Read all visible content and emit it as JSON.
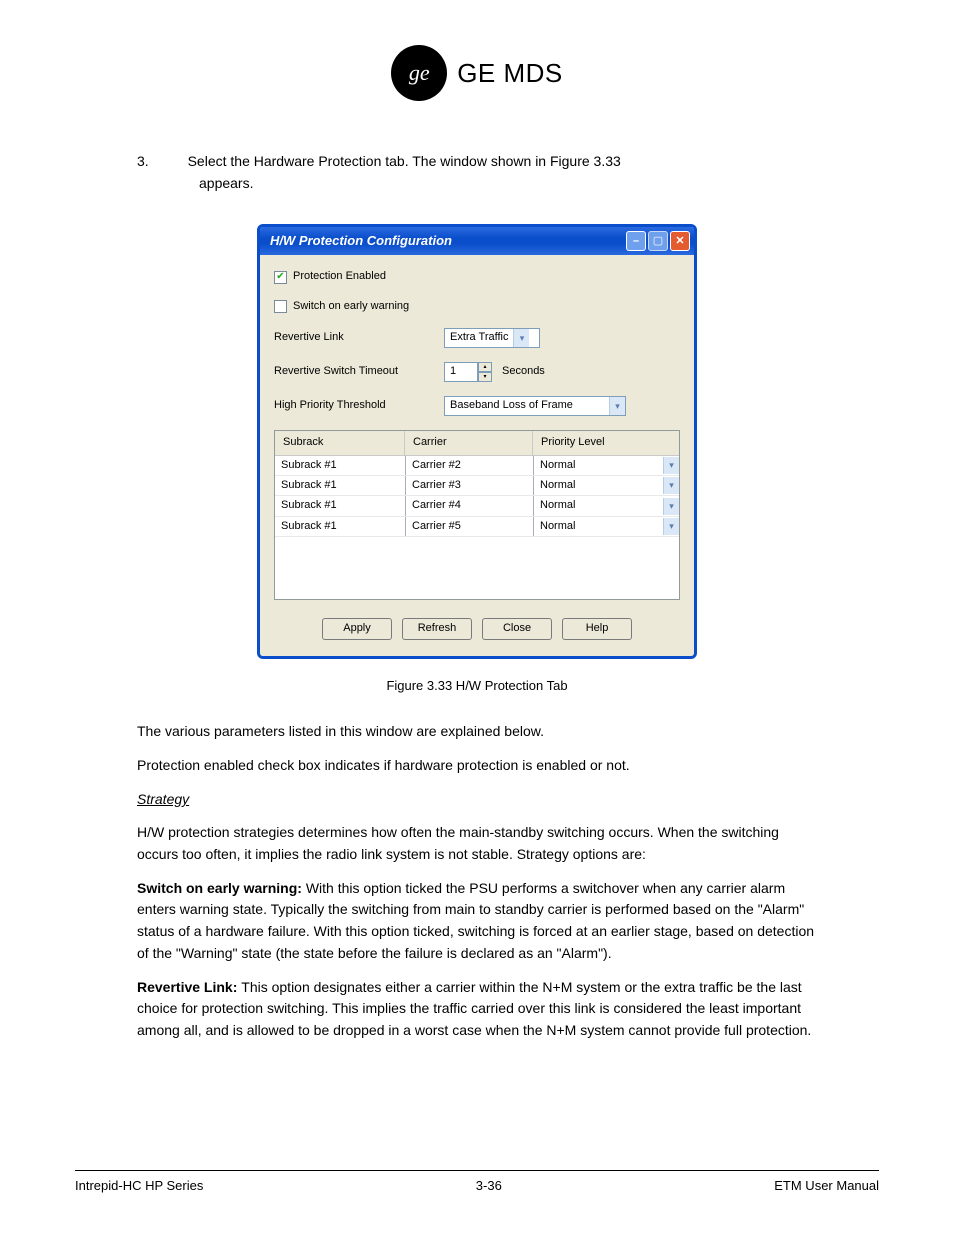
{
  "logo": {
    "monogram": "ge",
    "text": "GE MDS"
  },
  "intro": {
    "line1": "3.",
    "line1rest": "Select the Hardware Protection tab. The window shown in Figure 3.33",
    "line2": "appears."
  },
  "dialog": {
    "title": "H/W Protection Configuration",
    "checkboxes": {
      "protection_enabled": {
        "label": "Protection Enabled",
        "checked": true
      },
      "switch_early": {
        "label": "Switch on early warning",
        "checked": false
      }
    },
    "fields": {
      "revertive_link": {
        "label": "Revertive Link",
        "value": "Extra Traffic"
      },
      "revertive_timeout": {
        "label": "Revertive Switch Timeout",
        "value": "1",
        "unit": "Seconds"
      },
      "high_priority": {
        "label": "High Priority Threshold",
        "value": "Baseband Loss of Frame"
      }
    },
    "table": {
      "headers": {
        "subrack": "Subrack",
        "carrier": "Carrier",
        "priority": "Priority Level"
      },
      "rows": [
        {
          "subrack": "Subrack #1",
          "carrier": "Carrier #2",
          "priority": "Normal"
        },
        {
          "subrack": "Subrack #1",
          "carrier": "Carrier #3",
          "priority": "Normal"
        },
        {
          "subrack": "Subrack #1",
          "carrier": "Carrier #4",
          "priority": "Normal"
        },
        {
          "subrack": "Subrack #1",
          "carrier": "Carrier #5",
          "priority": "Normal"
        }
      ]
    },
    "buttons": {
      "apply": "Apply",
      "refresh": "Refresh",
      "close": "Close",
      "help": "Help"
    }
  },
  "caption": "Figure 3.33  H/W Protection Tab",
  "body": {
    "p1": "The various parameters listed in this window are explained below.",
    "p2": "Protection enabled check box indicates if hardware protection is enabled or not.",
    "sub1": "Strategy",
    "p3": "H/W protection strategies determines how often the main-standby switching occurs. When the switching occurs too often, it implies the radio link system is not stable. Strategy options are:",
    "p4a": "Switch on early warning: ",
    "p4b": "With this option ticked the PSU performs a switchover when any carrier alarm enters warning state. Typically the switching from main to standby carrier is performed based on the \"Alarm\" status of a hardware failure. With this option ticked, switching is forced at an earlier stage, based on detection of the \"Warning\" state (the state before the failure is declared as an \"Alarm\").",
    "p5a": "Revertive Link: ",
    "p5b": "This option designates either a carrier within the N+M system or the extra traffic be the last choice for protection switching. This implies the traffic carried over this link is considered the least important among all, and is allowed to be dropped in a worst case when the N+M system cannot provide full protection."
  },
  "footer": {
    "left": "Intrepid-HC HP Series",
    "center": "3-36",
    "right": "ETM User Manual"
  }
}
